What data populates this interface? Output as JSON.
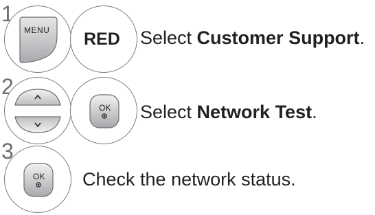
{
  "steps": [
    {
      "number": "1",
      "keys": [
        {
          "type": "menu-key",
          "label": "MENU"
        },
        {
          "type": "color-key",
          "label": "RED"
        }
      ],
      "text_prefix": "Select ",
      "text_bold": "Customer Support",
      "text_suffix": "."
    },
    {
      "number": "2",
      "keys": [
        {
          "type": "up-down-keys",
          "icons": [
            "up-arrow-icon",
            "down-arrow-icon"
          ]
        },
        {
          "type": "ok-key",
          "label": "OK"
        }
      ],
      "text_prefix": "Select ",
      "text_bold": "Network Test",
      "text_suffix": "."
    },
    {
      "number": "3",
      "keys": [
        {
          "type": "ok-key",
          "label": "OK"
        }
      ],
      "text_prefix": "Check the network status.",
      "text_bold": "",
      "text_suffix": ""
    }
  ],
  "colors": {
    "outline": "#7a7b7e",
    "key_fill": "#a7a9ac",
    "key_fill_light": "#d1d3d4",
    "text": "#231f20",
    "step_number": "#6d6e71"
  }
}
